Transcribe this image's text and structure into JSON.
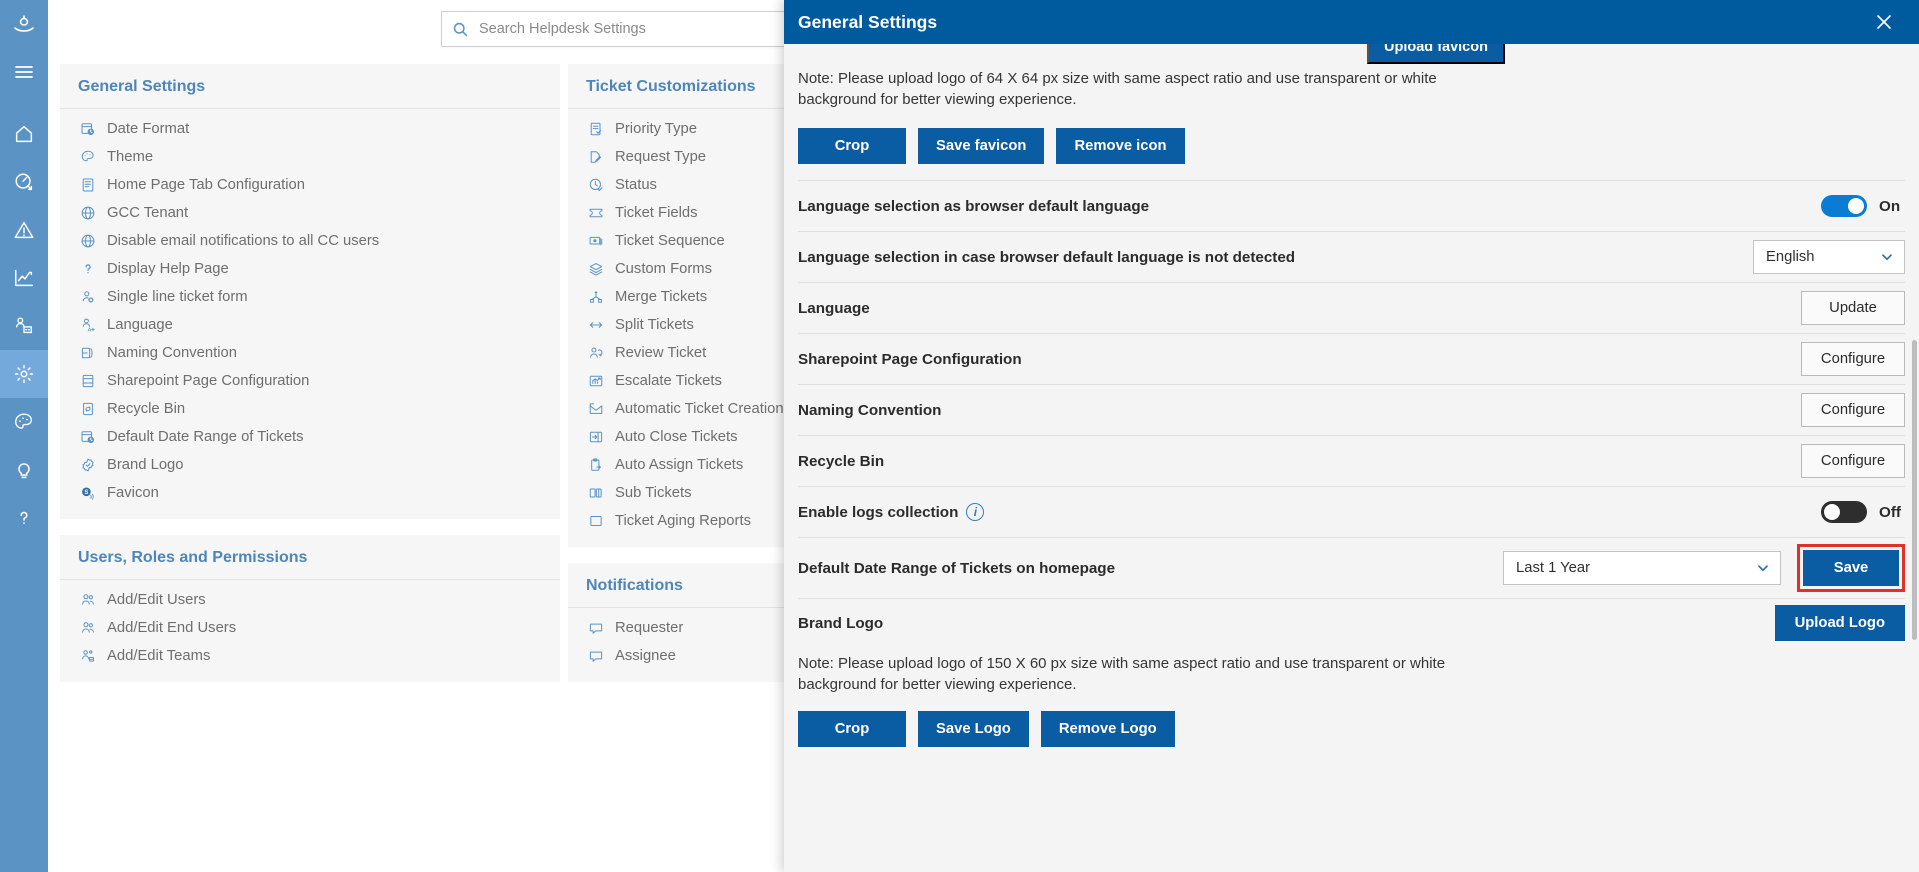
{
  "colors": {
    "rail": "#5b93c4",
    "rail_active": "#74aadb",
    "modal_header": "#005a9e",
    "primary_button": "#0a5ca3",
    "accent_link": "#4d86b8",
    "highlight_border": "#e0302a",
    "toggle_on": "#0a7cd4",
    "toggle_off": "#2e2e2e"
  },
  "rail": {
    "items": [
      {
        "name": "logo-icon",
        "label": "Helpdesk Logo"
      },
      {
        "name": "hamburger-menu-icon",
        "label": "Menu"
      },
      {
        "name": "home-icon",
        "label": "Home"
      },
      {
        "name": "dashboard-icon",
        "label": "Dashboard"
      },
      {
        "name": "alerts-icon",
        "label": "Alerts"
      },
      {
        "name": "reports-icon",
        "label": "Reports"
      },
      {
        "name": "teams-icon",
        "label": "Teams"
      },
      {
        "name": "settings-gear-icon",
        "label": "Settings",
        "active": true
      },
      {
        "name": "theme-palette-icon",
        "label": "Theme"
      },
      {
        "name": "ideas-bulb-icon",
        "label": "Ideas"
      },
      {
        "name": "help-question-icon",
        "label": "Help"
      }
    ]
  },
  "search": {
    "placeholder": "Search Helpdesk Settings",
    "value": "",
    "icon": "search-icon"
  },
  "columns": [
    {
      "title": "General Settings",
      "items": [
        {
          "label": "Date Format",
          "icon": "date-format-icon"
        },
        {
          "label": "Theme",
          "icon": "theme-palette-icon"
        },
        {
          "label": "Home Page Tab Configuration",
          "icon": "page-tab-icon"
        },
        {
          "label": "GCC Tenant",
          "icon": "globe-icon"
        },
        {
          "label": "Disable email notifications to all CC users",
          "icon": "globe-icon"
        },
        {
          "label": "Display Help Page",
          "icon": "question-icon"
        },
        {
          "label": "Single line ticket form",
          "icon": "user-disable-icon"
        },
        {
          "label": "Language",
          "icon": "language-icon"
        },
        {
          "label": "Naming Convention",
          "icon": "naming-convention-icon"
        },
        {
          "label": "Sharepoint Page Configuration",
          "icon": "sharepoint-page-icon"
        },
        {
          "label": "Recycle Bin",
          "icon": "recycle-bin-icon"
        },
        {
          "label": "Default Date Range of Tickets",
          "icon": "date-range-icon"
        },
        {
          "label": "Brand Logo",
          "icon": "brand-badge-icon"
        },
        {
          "label": "Favicon",
          "icon": "favicon-icon"
        }
      ]
    },
    {
      "title": "Users, Roles and Permissions",
      "items": [
        {
          "label": "Add/Edit Users",
          "icon": "users-icon"
        },
        {
          "label": "Add/Edit End Users",
          "icon": "end-users-icon"
        },
        {
          "label": "Add/Edit Teams",
          "icon": "teams-icon"
        }
      ]
    },
    {
      "title": "Ticket Customizations",
      "items": [
        {
          "label": "Priority Type",
          "icon": "priority-list-icon"
        },
        {
          "label": "Request Type",
          "icon": "request-edit-icon"
        },
        {
          "label": "Status",
          "icon": "status-clock-icon"
        },
        {
          "label": "Ticket Fields",
          "icon": "ticket-icon"
        },
        {
          "label": "Ticket Sequence",
          "icon": "sequence-icon"
        },
        {
          "label": "Custom Forms",
          "icon": "layers-icon"
        },
        {
          "label": "Merge Tickets",
          "icon": "merge-icon"
        },
        {
          "label": "Split Tickets",
          "icon": "split-arrows-icon"
        },
        {
          "label": "Review Ticket",
          "icon": "review-users-icon"
        },
        {
          "label": "Escalate Tickets",
          "icon": "escalate-chart-icon"
        },
        {
          "label": "Automatic Ticket Creation",
          "icon": "auto-mail-icon"
        },
        {
          "label": "Auto Close Tickets",
          "icon": "auto-close-icon"
        },
        {
          "label": "Auto Assign Tickets",
          "icon": "clipboard-arrow-icon"
        },
        {
          "label": "Sub Tickets",
          "icon": "sub-tickets-icon"
        },
        {
          "label": "Ticket Aging Reports",
          "icon": "square-icon"
        }
      ]
    },
    {
      "title": "Notifications",
      "items": [
        {
          "label": "Requester",
          "icon": "comment-icon"
        },
        {
          "label": "Assignee",
          "icon": "comment-icon"
        }
      ]
    }
  ],
  "modal": {
    "title": "General Settings",
    "close_icon": "close-icon",
    "upload_favicon_label": "Upload favicon",
    "favicon_note": "Note: Please upload logo of 64 X 64 px size with same aspect ratio and use transparent or white background for better viewing experience.",
    "favicon_buttons": [
      {
        "label": "Crop",
        "name": "crop-favicon-button"
      },
      {
        "label": "Save favicon",
        "name": "save-favicon-button"
      },
      {
        "label": "Remove icon",
        "name": "remove-icon-button"
      }
    ],
    "rows": [
      {
        "label": "Language selection as browser default language",
        "control": "toggle",
        "state": "on",
        "state_label": "On"
      },
      {
        "label": "Language selection in case browser default language is not detected",
        "control": "select",
        "value": "English"
      },
      {
        "label": "Language",
        "control": "button",
        "button_label": "Update"
      },
      {
        "label": "Sharepoint Page Configuration",
        "control": "button",
        "button_label": "Configure"
      },
      {
        "label": "Naming Convention",
        "control": "button",
        "button_label": "Configure"
      },
      {
        "label": "Recycle Bin",
        "control": "button",
        "button_label": "Configure"
      },
      {
        "label": "Enable logs collection",
        "control": "toggle",
        "state": "off",
        "state_label": "Off",
        "info_icon": "info-icon"
      },
      {
        "label": "Default Date Range of Tickets on homepage",
        "control": "select_with_save",
        "value": "Last 1 Year",
        "save_label": "Save",
        "highlighted": true
      }
    ],
    "brand_logo": {
      "label": "Brand Logo",
      "upload_label": "Upload Logo",
      "note": "Note: Please upload logo of 150 X 60 px size with same aspect ratio and use transparent or white background for better viewing experience.",
      "buttons": [
        {
          "label": "Crop",
          "name": "crop-logo-button"
        },
        {
          "label": "Save Logo",
          "name": "save-logo-button"
        },
        {
          "label": "Remove Logo",
          "name": "remove-logo-button"
        }
      ]
    }
  }
}
